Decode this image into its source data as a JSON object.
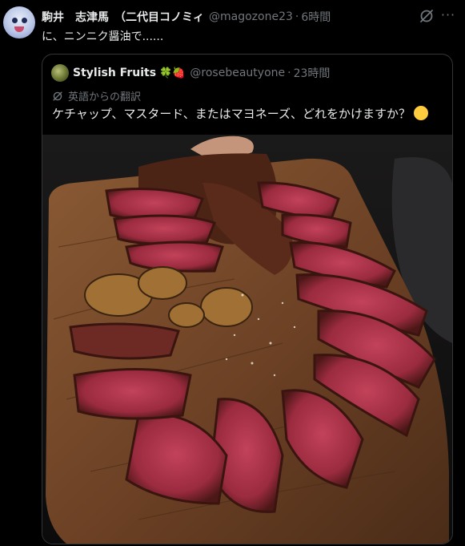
{
  "post": {
    "display_name": "駒井　志津馬　（二代目コノミィ",
    "handle": "@magozone23",
    "separator": "·",
    "time": "6時間",
    "text": "に、ニンニク醤油で......",
    "more_label": "···"
  },
  "quoted": {
    "display_name": "Stylish Fruits",
    "name_emojis": "🍀🍓",
    "handle": "@rosebeautyone",
    "separator": "·",
    "time": "23時間",
    "translation_label": "英語からの翻訳",
    "text": "ケチャップ、マスタード、またはマヨネーズ、どれをかけますか？",
    "text_emoji": "🤔",
    "photo_subject": "sliced steak on wooden cutting board"
  },
  "colors": {
    "background": "#000000",
    "primary_text": "#e7e9ea",
    "secondary_text": "#71767b",
    "border": "#333639"
  }
}
